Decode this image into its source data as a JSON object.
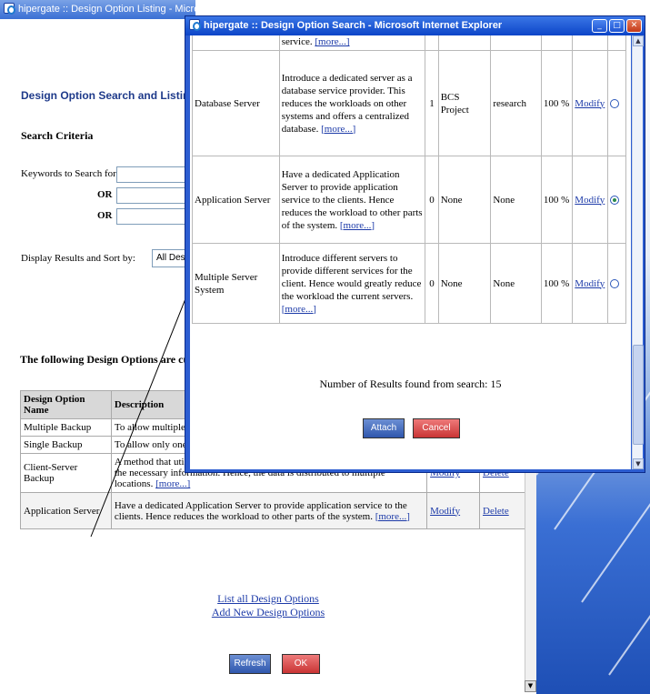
{
  "background_window": {
    "title": "hipergate :: Design Option Listing - Microso",
    "page_heading": "Design Option Search and Listing for \"h",
    "search_criteria_heading": "Search Criteria",
    "keywords_label": "Keywords to Search for:",
    "or_label_1": "OR",
    "or_label_2": "OR",
    "display_label": "Display Results and Sort by:",
    "display_select_value": "All Design Opt",
    "current_heading": "The following Design Options are current",
    "table": {
      "headers": [
        "Design Option Name",
        "Description"
      ],
      "rows": [
        {
          "name": "Multiple Backup",
          "description": "To allow multiple cl",
          "more": "",
          "modify": "",
          "delete": ""
        },
        {
          "name": "Single Backup",
          "description": "To allow only one s",
          "more": "",
          "modify": "",
          "delete": ""
        },
        {
          "name": "Client-Server Backup",
          "description": "A method that utilizes both the Client and Server to backup certain parts of the necessary information. Hence, the data is distributed to multiple locations.",
          "more": "[more...]",
          "modify": "Modify",
          "delete": "Delete"
        },
        {
          "name": "Application Server",
          "description": "Have a dedicated Application Server to provide application service to the clients. Hence reduces the workload to other parts of the system.",
          "more": "[more...]",
          "modify": "Modify",
          "delete": "Delete"
        }
      ]
    },
    "list_all_link": "List all Design Options",
    "add_new_link": "Add New Design Options",
    "refresh_button": "Refresh",
    "ok_button": "OK"
  },
  "popup_window": {
    "title": "hipergate :: Design Option Search - Microsoft Internet Explorer",
    "top_partial_text": "service.",
    "top_partial_more": "[more...]",
    "rows": [
      {
        "name": "Database Server",
        "description": "Introduce a dedicated server as a database service provider. This reduces the workloads on other systems and offers a centralized database.",
        "more": "[more...]",
        "count": "1",
        "project": "BCS Project",
        "type": "research",
        "percent": "100 %",
        "modify": "Modify",
        "selected": false
      },
      {
        "name": "Application Server",
        "description": "Have a dedicated Application Server to provide application service to the clients. Hence reduces the workload to other parts of the system.",
        "more": "[more...]",
        "count": "0",
        "project": "None",
        "type": "None",
        "percent": "100 %",
        "modify": "Modify",
        "selected": true
      },
      {
        "name": "Multiple Server System",
        "description": "Introduce different servers to provide different services for the client. Hence would greatly reduce the workload the current servers.",
        "more": "[more...]",
        "count": "0",
        "project": "None",
        "type": "None",
        "percent": "100 %",
        "modify": "Modify",
        "selected": false
      }
    ],
    "results_label": "Number of Results found from search:",
    "results_count": "15",
    "attach_button": "Attach",
    "cancel_button": "Cancel"
  },
  "colors": {
    "title_blue": "#0c45c8",
    "link_blue": "#1c3aa8",
    "heading_blue": "#1e3a8a",
    "button_red": "#c93434",
    "button_blue": "#2f57ad"
  }
}
